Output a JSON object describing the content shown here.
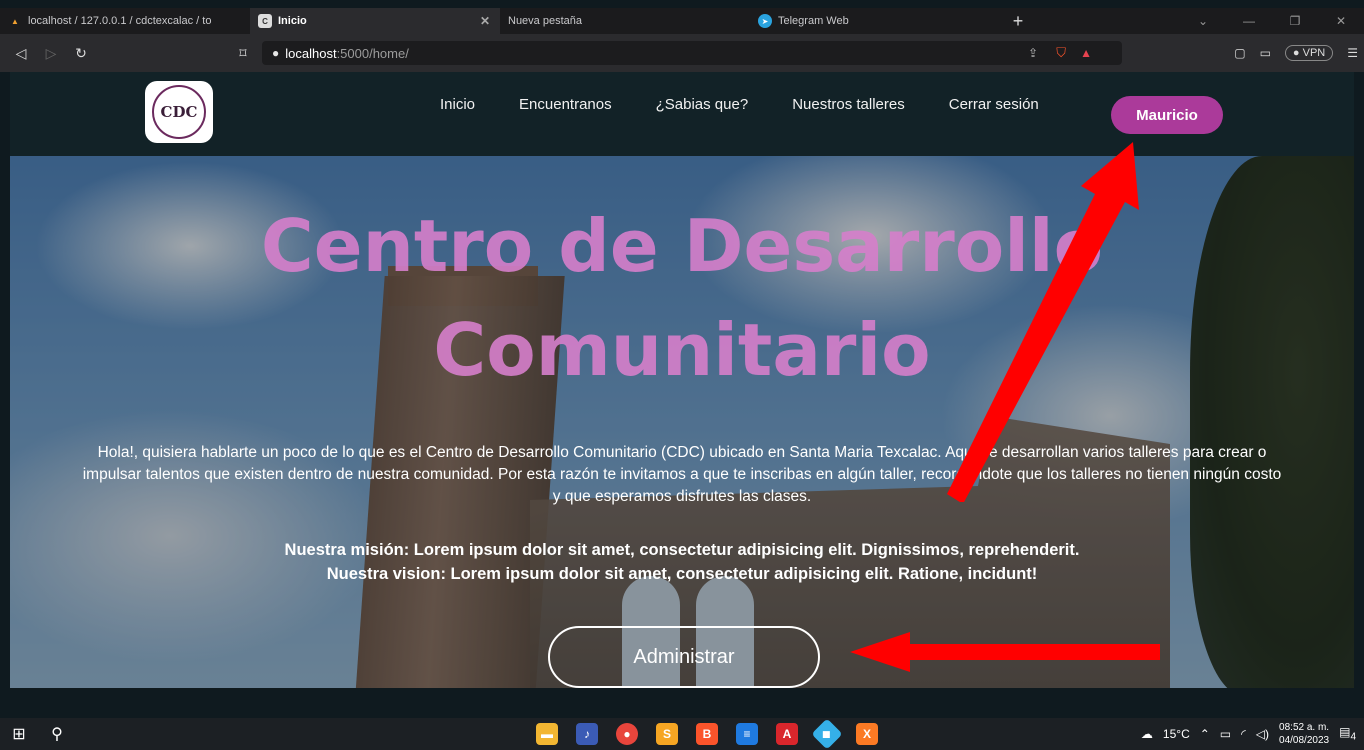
{
  "browser": {
    "tabs": [
      {
        "title": "localhost / 127.0.0.1 / cdctexcalac / to",
        "favicon": "phpmyadmin-icon",
        "active": false,
        "closable": false
      },
      {
        "title": "Inicio",
        "favicon": "site-icon",
        "active": true,
        "closable": true
      },
      {
        "title": "Nueva pestaña",
        "favicon": "",
        "active": false,
        "closable": false
      },
      {
        "title": "Telegram Web",
        "favicon": "telegram-icon",
        "active": false,
        "closable": false
      }
    ],
    "new_tab_symbol": "+",
    "url_host": "localhost",
    "url_path": ":5000/home/",
    "vpn_label": "VPN"
  },
  "site": {
    "logo_text": "CDC",
    "nav": [
      {
        "label": "Inicio"
      },
      {
        "label": "Encuentranos"
      },
      {
        "label": "¿Sabias que?"
      },
      {
        "label": "Nuestros talleres"
      },
      {
        "label": "Cerrar sesión"
      }
    ],
    "user_button": "Mauricio",
    "hero": {
      "title": "Centro de Desarrollo Comunitario",
      "intro": "Hola!, quisiera hablarte un poco de lo que es el Centro de Desarrollo Comunitario (CDC) ubicado en Santa Maria Texcalac. Aquí se desarrollan varios talleres para crear o impulsar talentos que existen dentro de nuestra comunidad. Por esta razón te invitamos a que te inscribas en algún taller, recordandote que los talleres no tienen ningún costo y que esperamos disfrutes las clases.",
      "mision": "Nuestra misión: Lorem ipsum dolor sit amet, consectetur adipisicing elit. Dignissimos, reprehenderit.",
      "vision": "Nuestra vision: Lorem ipsum dolor sit amet, consectetur adipisicing elit. Ratione, incidunt!",
      "admin_button": "Administrar"
    }
  },
  "colors": {
    "accent": "#ab3a9a",
    "title_pink": "#d67fcb",
    "header_bg": "#122227",
    "annotation_arrow": "#ff0000"
  },
  "taskbar": {
    "weather": "15°C",
    "time": "08:52 a. m.",
    "date": "04/08/2023",
    "notifications": "4"
  }
}
